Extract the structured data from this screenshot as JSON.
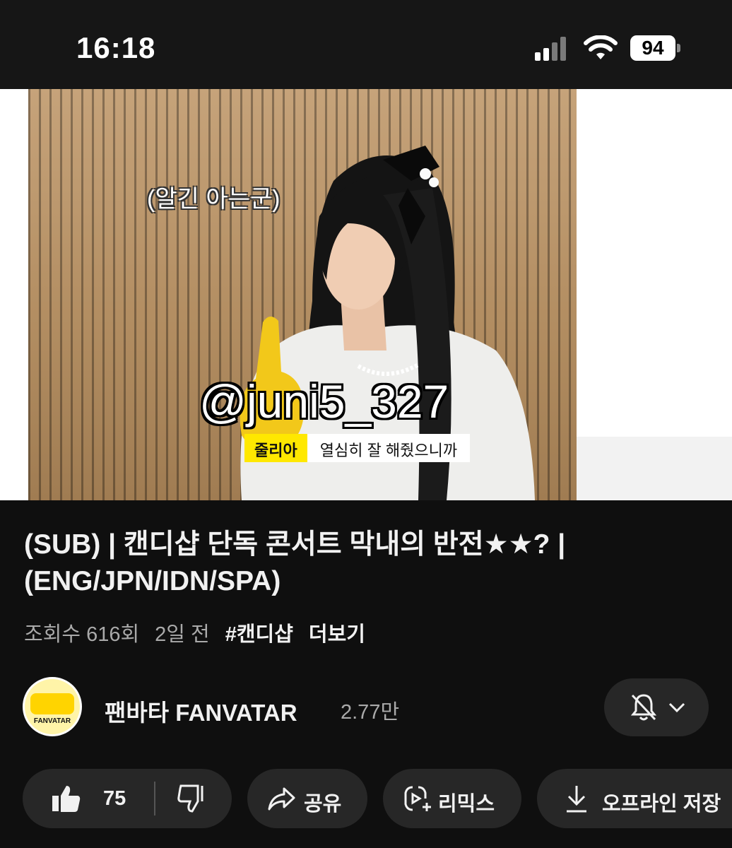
{
  "status_bar": {
    "time": "16:18",
    "battery": "94"
  },
  "video": {
    "caption_top": "(알긴 아는군)",
    "subtitle_name": "줄리아",
    "subtitle_text": "열심히 잘 해줬으니까",
    "watermark": "@juni5_327"
  },
  "title": "(SUB) | 캔디샵 단독 콘서트 막내의 반전★★? | (ENG/JPN/IDN/SPA)",
  "meta": {
    "views": "조회수 616회",
    "age": "2일 전",
    "hashtag": "#캔디샵",
    "more": "더보기"
  },
  "channel": {
    "name": "팬바타 FANVATAR",
    "subscribers": "2.77만",
    "avatar_text": "FANVATAR"
  },
  "actions": {
    "like_count": "75",
    "share_label": "공유",
    "remix_label": "리믹스",
    "download_label": "오프라인 저장"
  },
  "icons": {
    "like": "thumbs-up-icon",
    "dislike": "thumbs-down-icon",
    "share": "share-arrow-icon",
    "remix": "remix-icon",
    "download": "download-icon",
    "bell": "bell-off-icon",
    "chevron": "chevron-down-icon"
  },
  "colors": {
    "background": "#0f0f0f",
    "pill": "#272727",
    "subtitle_name_bg": "#ffe800",
    "secondary_text": "#aaaaaa"
  }
}
